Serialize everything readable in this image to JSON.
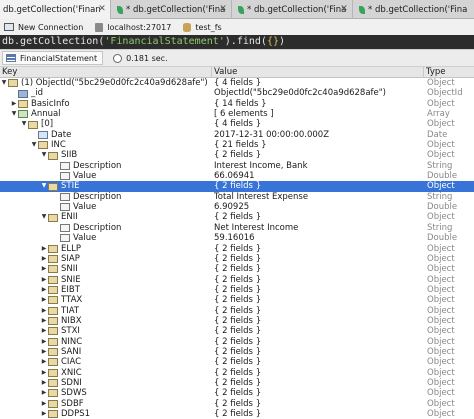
{
  "tabs": [
    {
      "label": "db.getCollection('Finan",
      "close": "✕",
      "active": true
    },
    {
      "label": "* db.getCollection('Fina",
      "close": "✕",
      "active": false
    },
    {
      "label": "* db.getCollection('Fina",
      "close": "✕",
      "active": false
    },
    {
      "label": "* db.getCollection('Fina",
      "close": "",
      "active": false
    }
  ],
  "connection": {
    "new_connection": "New Connection",
    "server": "localhost:27017",
    "database": "test_fs"
  },
  "query": {
    "prefix": "db.getCollection(",
    "collection": "'FinancialStatement'",
    "middle": ").find(",
    "args": "{}",
    "suffix": ")"
  },
  "result": {
    "collection": "FinancialStatement",
    "time": "0.181 sec."
  },
  "columns": {
    "key": "Key",
    "value": "Value",
    "type": "Type"
  },
  "rows": [
    {
      "indent": 0,
      "arrow": "▼",
      "icon": "root",
      "key": "(1) ObjectId(\"5bc29e0d0fc2c40a9d628afe\")",
      "value": "{ 4 fields }",
      "type": "Object"
    },
    {
      "indent": 1,
      "arrow": "",
      "icon": "objid",
      "key": "_id",
      "value": "ObjectId(\"5bc29e0d0fc2c40a9d628afe\")",
      "type": "ObjectId"
    },
    {
      "indent": 1,
      "arrow": "▶",
      "icon": "doc",
      "key": "BasicInfo",
      "value": "{ 14 fields }",
      "type": "Object"
    },
    {
      "indent": 1,
      "arrow": "▼",
      "icon": "arr",
      "key": "Annual",
      "value": "[ 6 elements ]",
      "type": "Array"
    },
    {
      "indent": 2,
      "arrow": "▼",
      "icon": "doc",
      "key": "[0]",
      "value": "{ 4 fields }",
      "type": "Object"
    },
    {
      "indent": 3,
      "arrow": "",
      "icon": "date",
      "key": "Date",
      "value": "2017-12-31 00:00:00.000Z",
      "type": "Date"
    },
    {
      "indent": 3,
      "arrow": "▼",
      "icon": "doc",
      "key": "INC",
      "value": "{ 21 fields }",
      "type": "Object"
    },
    {
      "indent": 4,
      "arrow": "▼",
      "icon": "doc",
      "key": "SIIB",
      "value": "{ 2 fields }",
      "type": "Object"
    },
    {
      "indent": 5,
      "arrow": "",
      "icon": "str",
      "key": "Description",
      "value": "Interest Income, Bank",
      "type": "String"
    },
    {
      "indent": 5,
      "arrow": "",
      "icon": "num",
      "key": "Value",
      "value": "66.06941",
      "type": "Double"
    },
    {
      "indent": 4,
      "arrow": "▼",
      "icon": "doc",
      "key": "STIE",
      "value": "{ 2 fields }",
      "type": "Object",
      "selected": true
    },
    {
      "indent": 5,
      "arrow": "",
      "icon": "str",
      "key": "Description",
      "value": "Total Interest Expense",
      "type": "String"
    },
    {
      "indent": 5,
      "arrow": "",
      "icon": "num",
      "key": "Value",
      "value": "6.90925",
      "type": "Double"
    },
    {
      "indent": 4,
      "arrow": "▼",
      "icon": "doc",
      "key": "ENII",
      "value": "{ 2 fields }",
      "type": "Object"
    },
    {
      "indent": 5,
      "arrow": "",
      "icon": "str",
      "key": "Description",
      "value": "Net Interest Income",
      "type": "String"
    },
    {
      "indent": 5,
      "arrow": "",
      "icon": "num",
      "key": "Value",
      "value": "59.16016",
      "type": "Double"
    },
    {
      "indent": 4,
      "arrow": "▶",
      "icon": "doc",
      "key": "ELLP",
      "value": "{ 2 fields }",
      "type": "Object"
    },
    {
      "indent": 4,
      "arrow": "▶",
      "icon": "doc",
      "key": "SIAP",
      "value": "{ 2 fields }",
      "type": "Object"
    },
    {
      "indent": 4,
      "arrow": "▶",
      "icon": "doc",
      "key": "SNII",
      "value": "{ 2 fields }",
      "type": "Object"
    },
    {
      "indent": 4,
      "arrow": "▶",
      "icon": "doc",
      "key": "SNIE",
      "value": "{ 2 fields }",
      "type": "Object"
    },
    {
      "indent": 4,
      "arrow": "▶",
      "icon": "doc",
      "key": "EIBT",
      "value": "{ 2 fields }",
      "type": "Object"
    },
    {
      "indent": 4,
      "arrow": "▶",
      "icon": "doc",
      "key": "TTAX",
      "value": "{ 2 fields }",
      "type": "Object"
    },
    {
      "indent": 4,
      "arrow": "▶",
      "icon": "doc",
      "key": "TIAT",
      "value": "{ 2 fields }",
      "type": "Object"
    },
    {
      "indent": 4,
      "arrow": "▶",
      "icon": "doc",
      "key": "NIBX",
      "value": "{ 2 fields }",
      "type": "Object"
    },
    {
      "indent": 4,
      "arrow": "▶",
      "icon": "doc",
      "key": "STXI",
      "value": "{ 2 fields }",
      "type": "Object"
    },
    {
      "indent": 4,
      "arrow": "▶",
      "icon": "doc",
      "key": "NINC",
      "value": "{ 2 fields }",
      "type": "Object"
    },
    {
      "indent": 4,
      "arrow": "▶",
      "icon": "doc",
      "key": "SANI",
      "value": "{ 2 fields }",
      "type": "Object"
    },
    {
      "indent": 4,
      "arrow": "▶",
      "icon": "doc",
      "key": "CIAC",
      "value": "{ 2 fields }",
      "type": "Object"
    },
    {
      "indent": 4,
      "arrow": "▶",
      "icon": "doc",
      "key": "XNIC",
      "value": "{ 2 fields }",
      "type": "Object"
    },
    {
      "indent": 4,
      "arrow": "▶",
      "icon": "doc",
      "key": "SDNI",
      "value": "{ 2 fields }",
      "type": "Object"
    },
    {
      "indent": 4,
      "arrow": "▶",
      "icon": "doc",
      "key": "SDWS",
      "value": "{ 2 fields }",
      "type": "Object"
    },
    {
      "indent": 4,
      "arrow": "▶",
      "icon": "doc",
      "key": "SDBF",
      "value": "{ 2 fields }",
      "type": "Object"
    },
    {
      "indent": 4,
      "arrow": "▶",
      "icon": "doc",
      "key": "DDPS1",
      "value": "{ 2 fields }",
      "type": "Object"
    }
  ],
  "colors": {
    "selection": "#3874d8",
    "query_bg": "#2c2c2c",
    "string_literal": "#8fc96c"
  }
}
